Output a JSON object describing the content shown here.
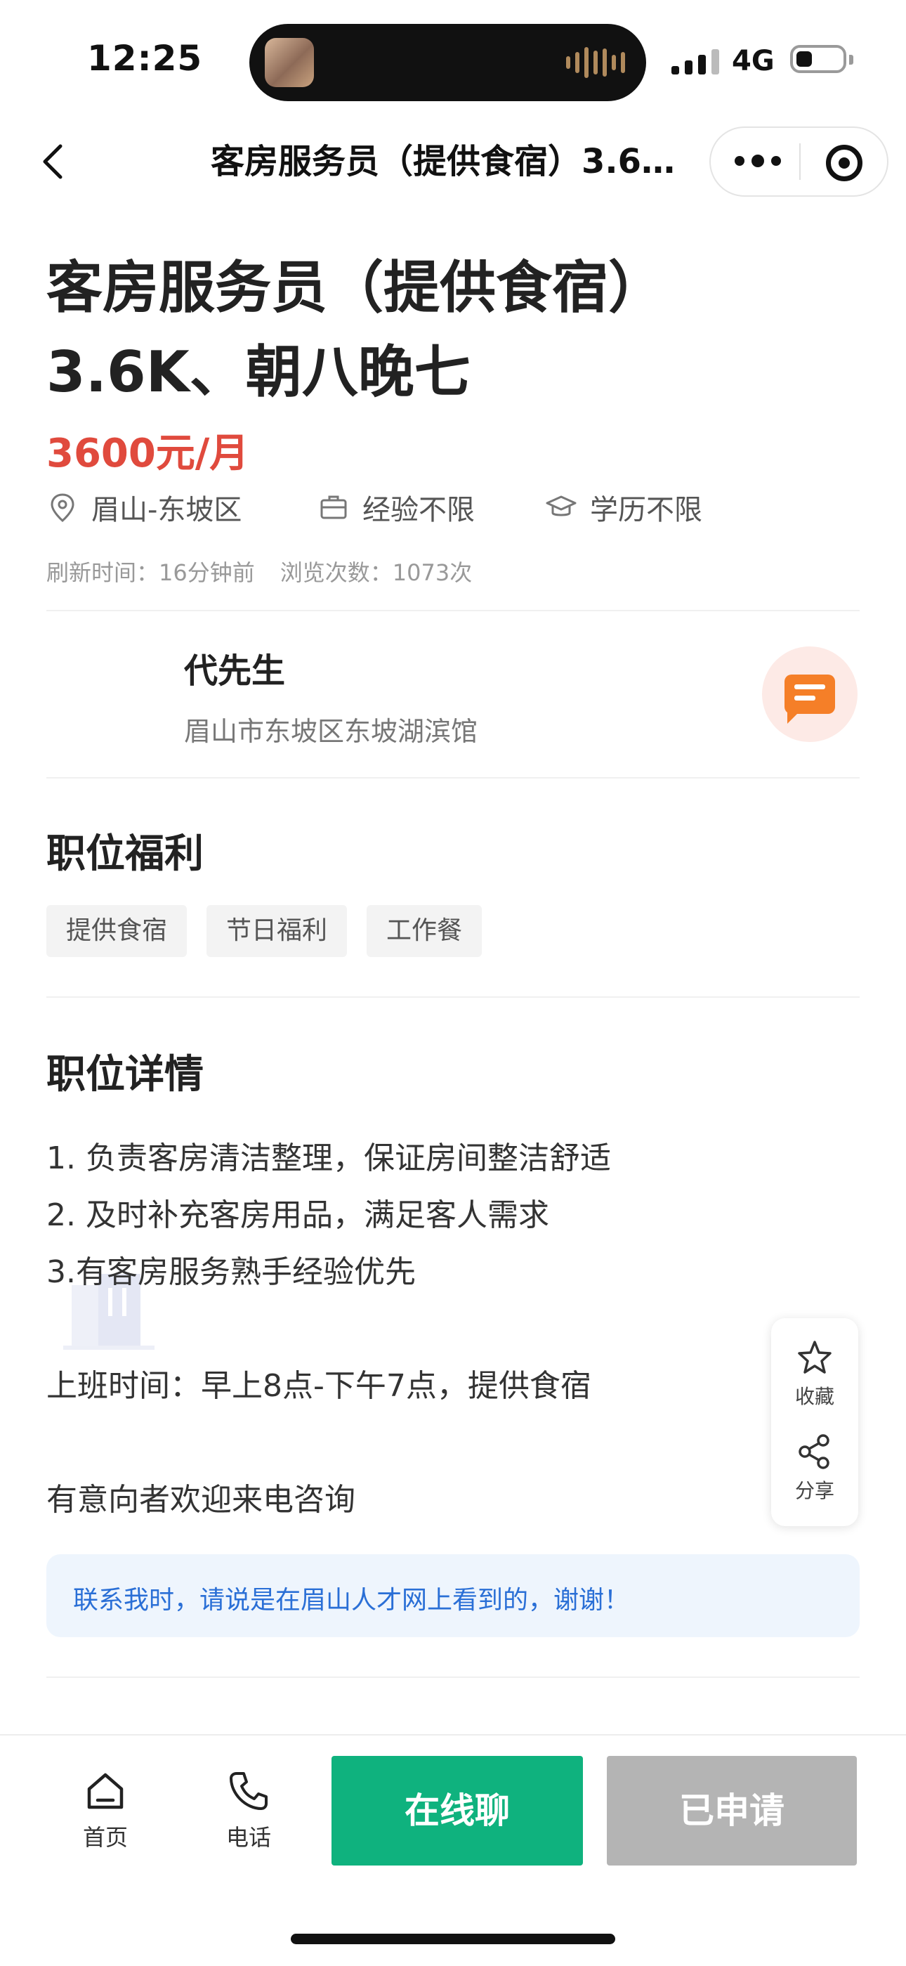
{
  "status_bar": {
    "time": "12:25",
    "network": "4G"
  },
  "nav": {
    "title": "客房服务员（提供食宿）3.6K…"
  },
  "job": {
    "title": "客房服务员（提供食宿）3.6K、朝八晚七",
    "salary": "3600元/月",
    "location": "眉山-东坡区",
    "experience": "经验不限",
    "education": "学历不限",
    "refresh_label": "刷新时间：",
    "refresh_value": "16分钟前",
    "views_label": "浏览次数：",
    "views_value": "1073次"
  },
  "employer": {
    "name": "代先生",
    "address": "眉山市东坡区东坡湖滨馆"
  },
  "benefits": {
    "heading": "职位福利",
    "tags": [
      "提供食宿",
      "节日福利",
      "工作餐"
    ]
  },
  "details": {
    "heading": "职位详情",
    "lines": [
      "1. 负责客房清洁整理，保证房间整洁舒适",
      "2. 及时补充客房用品，满足客人需求",
      "3.有客房服务熟手经验优先",
      "上班时间：早上8点-下午7点，提供食宿",
      "有意向者欢迎来电咨询"
    ]
  },
  "notice": "联系我时，请说是在眉山人才网上看到的，谢谢！",
  "side_tools": {
    "favorite": "收藏",
    "share": "分享"
  },
  "bottom_bar": {
    "home": "首页",
    "phone": "电话",
    "chat_online": "在线聊",
    "applied": "已申请"
  },
  "colors": {
    "salary": "#e04a3d",
    "primary_button": "#0fb27e",
    "disabled_button": "#b4b4b4",
    "chat_icon": "#f57f28",
    "notice_text": "#2a6fd6"
  }
}
